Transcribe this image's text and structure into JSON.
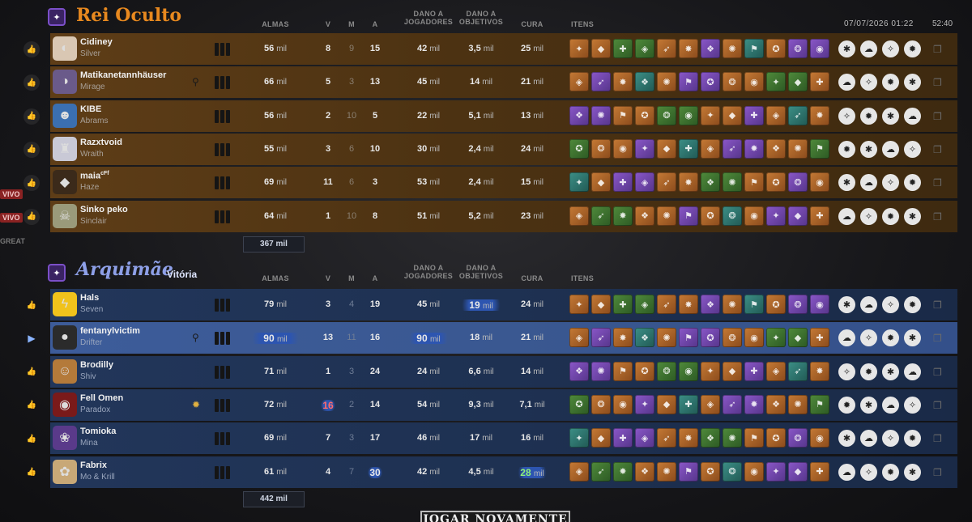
{
  "header": {
    "date": "07/07/2026 01:22",
    "duration": "52:40"
  },
  "side_labels": {
    "vivo1": "VIVO",
    "vivo2": "VIVO",
    "great": "GREAT"
  },
  "columns": {
    "souls": "ALMAS",
    "k": "V",
    "d": "M",
    "a": "A",
    "player_damage": "DANO A JOGADORES",
    "objective_damage": "DANO A OBJETIVOS",
    "healing": "CURA",
    "items": "ITENS"
  },
  "colors": {
    "team_a_accent": "#e8891f",
    "team_b_accent": "#5a6fd6",
    "row_a": "#5e3d17",
    "row_b": "#22365a",
    "row_highlight": "#3d5c9a"
  },
  "team_a": {
    "name": "Rei Oculto",
    "total_souls": "367 mil",
    "players": [
      {
        "name": "Cidiney",
        "hero": "Silver",
        "souls": "56 mil",
        "k": "8",
        "d": "9",
        "a": "15",
        "pdmg": "42 mil",
        "odmg": "3,5 mil",
        "heal": "25 mil",
        "avatar": "wolf-face-icon"
      },
      {
        "name": "Matikanetannhäuser",
        "hero": "Mirage",
        "souls": "66 mil",
        "k": "5",
        "d": "3",
        "a": "13",
        "pdmg": "45 mil",
        "odmg": "14 mil",
        "heal": "21 mil",
        "avatar": "mask-face-icon"
      },
      {
        "name": "KIBE",
        "hero": "Abrams",
        "souls": "56 mil",
        "k": "2",
        "d": "10",
        "a": "5",
        "pdmg": "22 mil",
        "odmg": "5,1 mil",
        "heal": "13 mil",
        "avatar": "blue-demon-icon"
      },
      {
        "name": "Razxtvoid",
        "hero": "Wraith",
        "souls": "55 mil",
        "k": "3",
        "d": "6",
        "a": "10",
        "pdmg": "30 mil",
        "odmg": "2,4 mil",
        "heal": "24 mil",
        "avatar": "top-hat-icon"
      },
      {
        "name": "maia",
        "name_sup": "cFf",
        "hero": "Haze",
        "souls": "69 mil",
        "k": "11",
        "d": "6",
        "a": "3",
        "pdmg": "53 mil",
        "odmg": "2,4 mil",
        "heal": "15 mil",
        "avatar": "hooded-figure-icon"
      },
      {
        "name": "Sinko peko",
        "hero": "Sinclair",
        "souls": "64 mil",
        "k": "1",
        "d": "10",
        "a": "8",
        "pdmg": "51 mil",
        "odmg": "5,2 mil",
        "heal": "23 mil",
        "avatar": "skull-icon"
      }
    ]
  },
  "team_b": {
    "name": "Arquimãe",
    "result": "Vitória",
    "total_souls": "442 mil",
    "players": [
      {
        "name": "Hals",
        "hero": "Seven",
        "souls": "79 mil",
        "k": "3",
        "d": "4",
        "a": "19",
        "pdmg": "45 mil",
        "odmg": "19 mil",
        "heal": "24 mil",
        "avatar": "pikachu-icon"
      },
      {
        "name": "fentanylvictim",
        "hero": "Drifter",
        "souls": "90 mil",
        "k": "13",
        "d": "11",
        "a": "16",
        "pdmg": "90 mil",
        "odmg": "18 mil",
        "heal": "21 mil",
        "avatar": "hooded-reaper-icon"
      },
      {
        "name": "Brodilly",
        "hero": "Shiv",
        "souls": "71 mil",
        "k": "1",
        "d": "3",
        "a": "24",
        "pdmg": "24 mil",
        "odmg": "6,6 mil",
        "heal": "14 mil",
        "avatar": "bandana-face-icon"
      },
      {
        "name": "Fell Omen",
        "hero": "Paradox",
        "souls": "72 mil",
        "k": "16",
        "d": "2",
        "a": "14",
        "pdmg": "54 mil",
        "odmg": "9,3 mil",
        "heal": "7,1 mil",
        "avatar": "red-eye-icon"
      },
      {
        "name": "Tomioka",
        "hero": "Mina",
        "souls": "69 mil",
        "k": "7",
        "d": "3",
        "a": "17",
        "pdmg": "46 mil",
        "odmg": "17 mil",
        "heal": "16 mil",
        "avatar": "purple-hair-icon"
      },
      {
        "name": "Fabrix",
        "hero": "Mo & Krill",
        "souls": "61 mil",
        "k": "4",
        "d": "7",
        "a": "30",
        "pdmg": "42 mil",
        "odmg": "4,5 mil",
        "heal": "28 mil",
        "avatar": "plush-toy-icon"
      }
    ]
  },
  "play_again": "JOGAR NOVAMENTE"
}
